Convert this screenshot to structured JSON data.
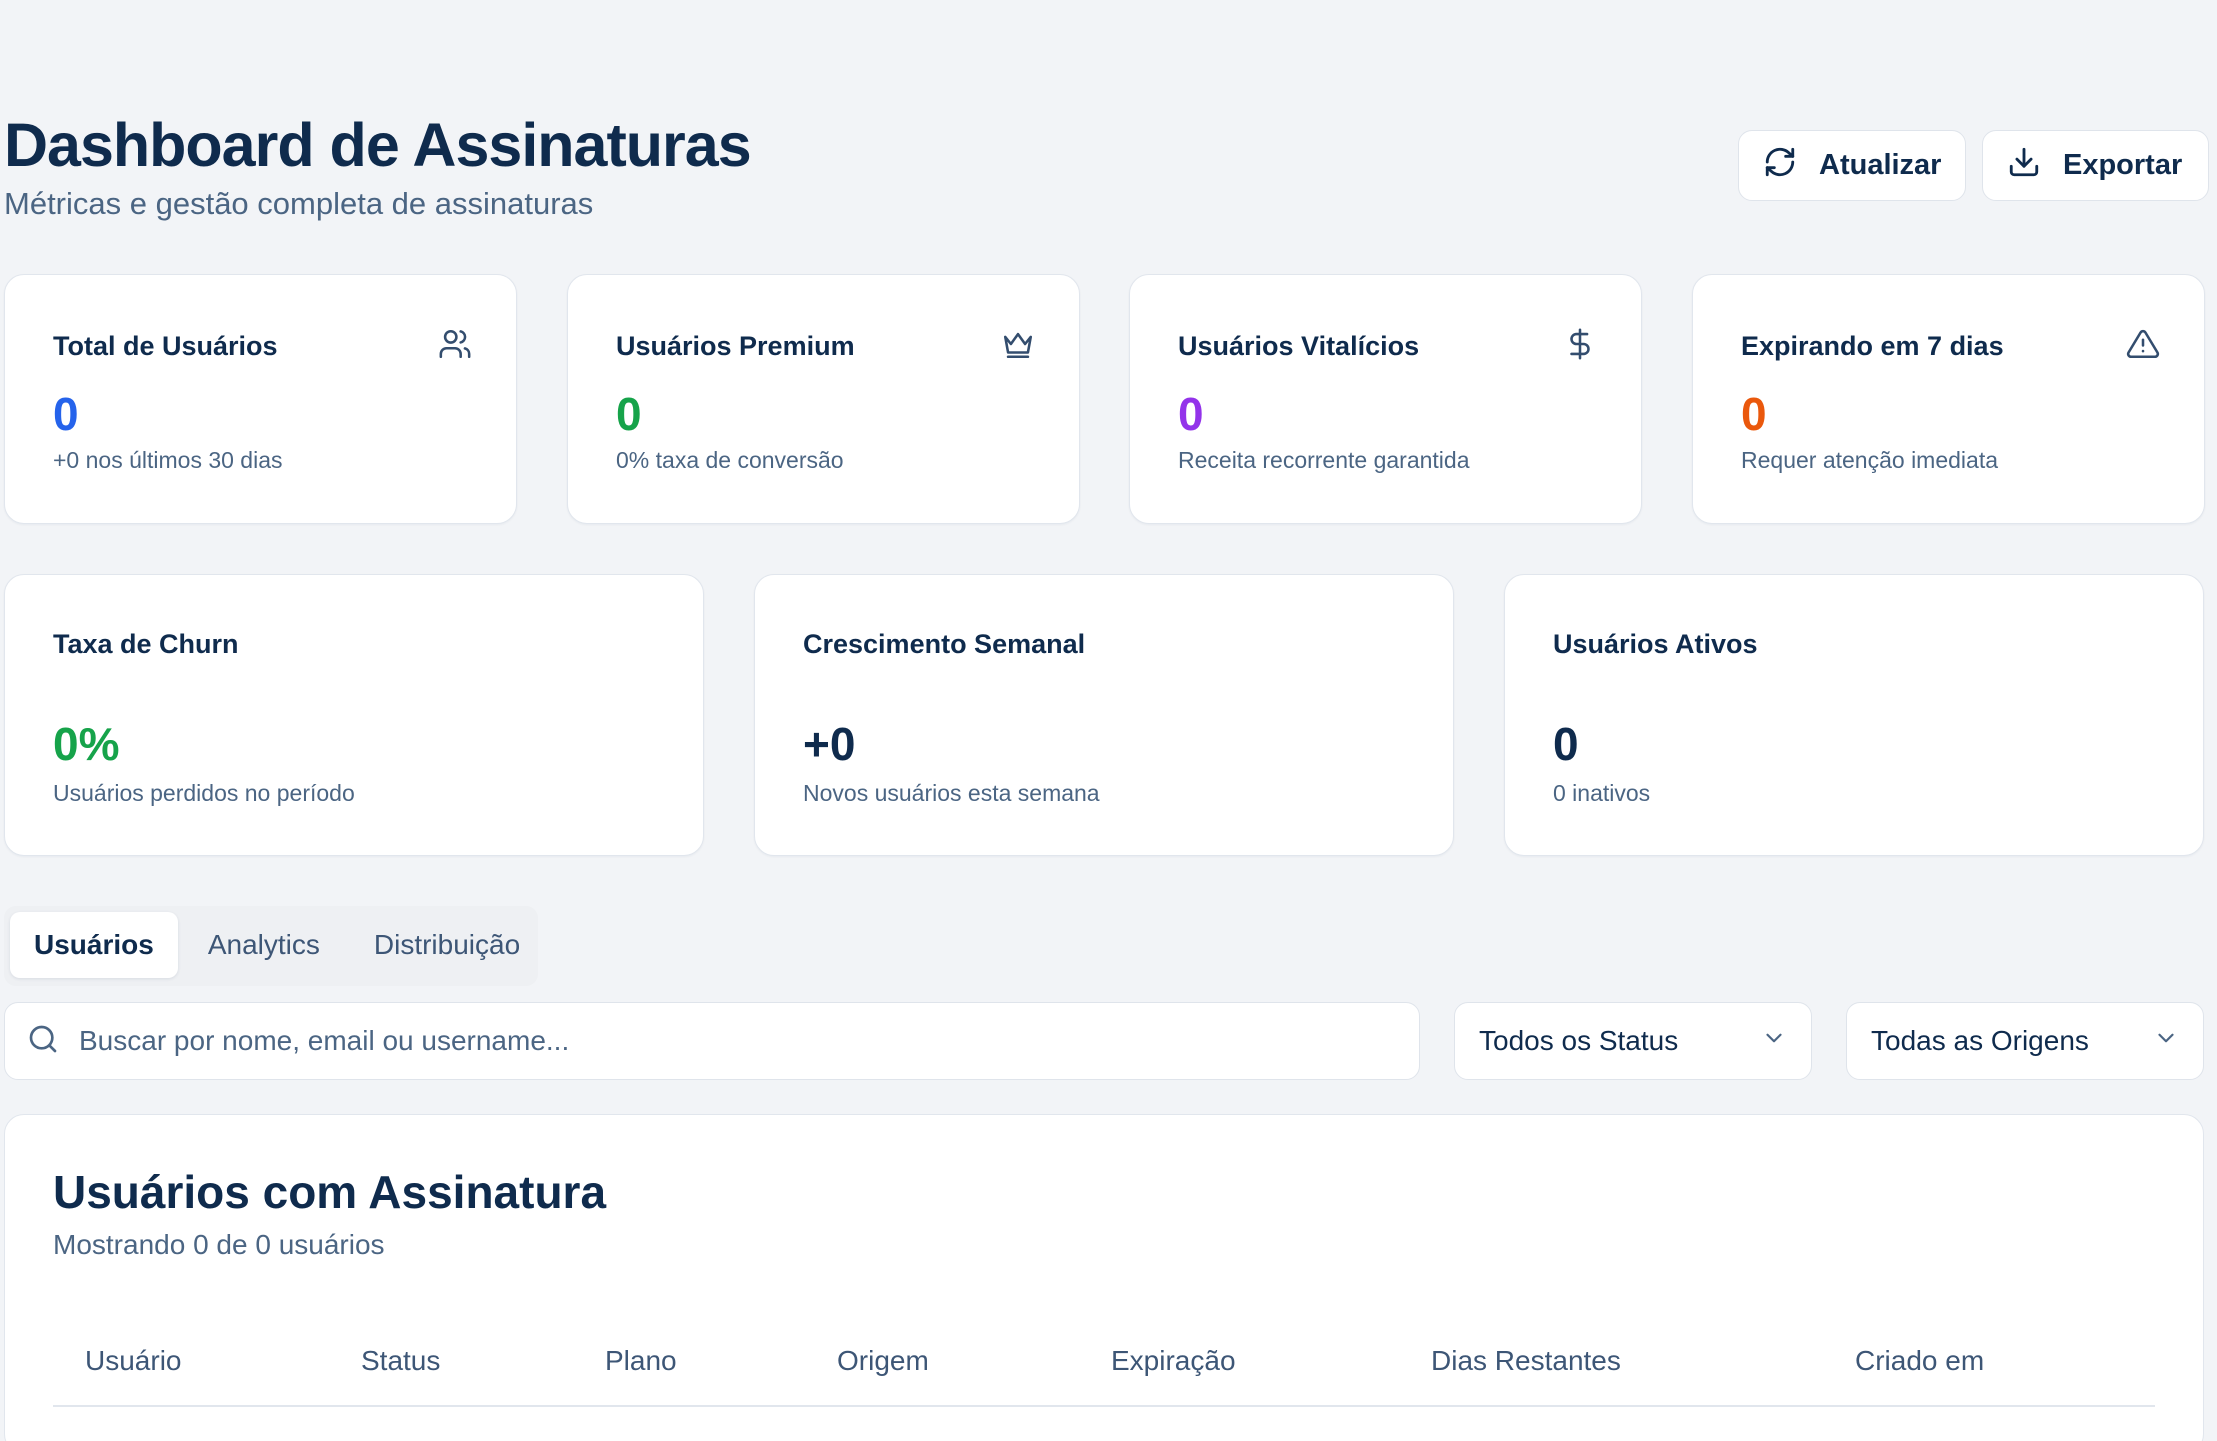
{
  "header": {
    "title": "Dashboard de Assinaturas",
    "subtitle": "Métricas e gestão completa de assinaturas",
    "refresh_label": "Atualizar",
    "export_label": "Exportar"
  },
  "stats": [
    {
      "title": "Total de Usuários",
      "value": "0",
      "sub": "+0 nos últimos 30 dias",
      "icon": "users-icon",
      "color": "#2563eb"
    },
    {
      "title": "Usuários Premium",
      "value": "0",
      "sub": "0% taxa de conversão",
      "icon": "crown-icon",
      "color": "#16a34a"
    },
    {
      "title": "Usuários Vitalícios",
      "value": "0",
      "sub": "Receita recorrente garantida",
      "icon": "dollar-icon",
      "color": "#9333ea"
    },
    {
      "title": "Expirando em 7 dias",
      "value": "0",
      "sub": "Requer atenção imediata",
      "icon": "alert-triangle-icon",
      "color": "#ea580c"
    }
  ],
  "metrics": [
    {
      "title": "Taxa de Churn",
      "value": "0%",
      "sub": "Usuários perdidos no período",
      "color": "#16a34a"
    },
    {
      "title": "Crescimento Semanal",
      "value": "+0",
      "sub": "Novos usuários esta semana",
      "color": "#0f2b4d"
    },
    {
      "title": "Usuários Ativos",
      "value": "0",
      "sub": "0 inativos",
      "color": "#0f2b4d"
    }
  ],
  "tabs": [
    {
      "label": "Usuários",
      "active": true
    },
    {
      "label": "Analytics",
      "active": false
    },
    {
      "label": "Distribuição",
      "active": false
    }
  ],
  "filters": {
    "search_placeholder": "Buscar por nome, email ou username...",
    "status_selected": "Todos os Status",
    "origin_selected": "Todas as Origens"
  },
  "table": {
    "title": "Usuários com Assinatura",
    "subtitle": "Mostrando 0 de 0 usuários",
    "columns": [
      "Usuário",
      "Status",
      "Plano",
      "Origem",
      "Expiração",
      "Dias Restantes",
      "Criado em"
    ]
  }
}
